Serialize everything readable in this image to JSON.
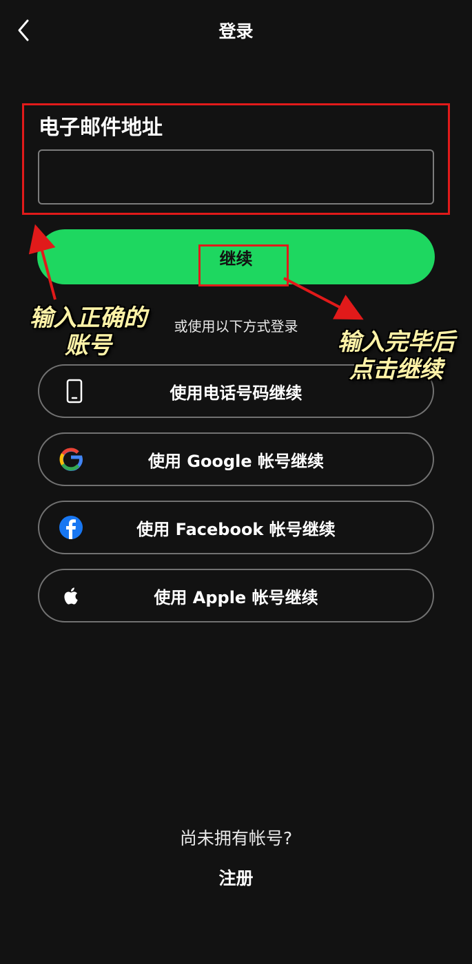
{
  "header": {
    "title": "登录",
    "back_icon": "chevron-left-icon"
  },
  "email": {
    "label": "电子邮件地址",
    "value": "",
    "placeholder": ""
  },
  "continue_label": "继续",
  "alt_login_text": "或使用以下方式登录",
  "options": [
    {
      "label": "使用电话号码继续",
      "icon": "phone-icon"
    },
    {
      "label": "使用 Google 帐号继续",
      "icon": "google-icon"
    },
    {
      "label": "使用 Facebook 帐号继续",
      "icon": "facebook-icon"
    },
    {
      "label": "使用 Apple 帐号继续",
      "icon": "apple-icon"
    }
  ],
  "footer": {
    "prompt": "尚未拥有帐号?",
    "signup_label": "注册"
  },
  "annotations": {
    "left_line1": "输入正确的",
    "left_line2": "账号",
    "right_line1": "输入完毕后",
    "right_line2": "点击继续"
  },
  "colors": {
    "background": "#121212",
    "accent": "#1ed760",
    "annotation_red": "#e11a1a",
    "annotation_text": "#fff3a8"
  }
}
